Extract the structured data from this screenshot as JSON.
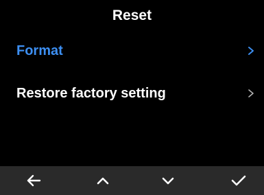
{
  "header": {
    "title": "Reset"
  },
  "menu": {
    "items": [
      {
        "label": "Format",
        "selected": true,
        "icon": "chevron-right-icon"
      },
      {
        "label": "Restore factory setting",
        "selected": false,
        "icon": "chevron-right-icon"
      }
    ]
  },
  "footer": {
    "buttons": [
      {
        "icon": "arrow-left-icon"
      },
      {
        "icon": "chevron-up-icon"
      },
      {
        "icon": "chevron-down-icon"
      },
      {
        "icon": "checkmark-icon"
      }
    ]
  },
  "colors": {
    "background": "#000000",
    "text": "#ffffff",
    "accent": "#3d8ff2",
    "footer": "#2a2a2a",
    "chevron_inactive": "#b3b3b3"
  }
}
